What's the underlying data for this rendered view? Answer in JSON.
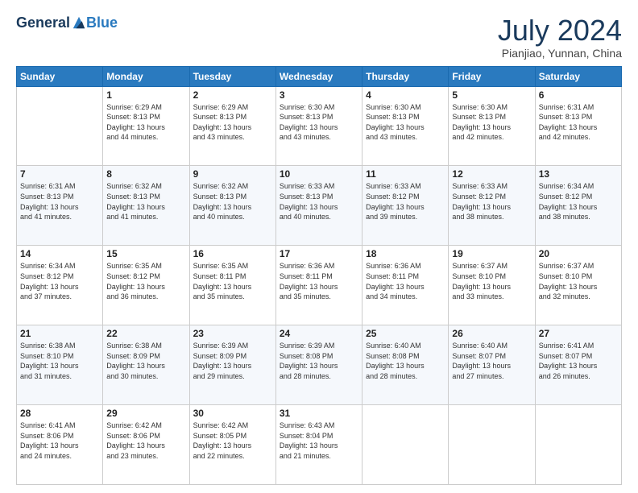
{
  "header": {
    "logo_general": "General",
    "logo_blue": "Blue",
    "main_title": "July 2024",
    "subtitle": "Pianjiao, Yunnan, China"
  },
  "calendar": {
    "days_of_week": [
      "Sunday",
      "Monday",
      "Tuesday",
      "Wednesday",
      "Thursday",
      "Friday",
      "Saturday"
    ],
    "weeks": [
      [
        {
          "day": "",
          "info": ""
        },
        {
          "day": "1",
          "info": "Sunrise: 6:29 AM\nSunset: 8:13 PM\nDaylight: 13 hours\nand 44 minutes."
        },
        {
          "day": "2",
          "info": "Sunrise: 6:29 AM\nSunset: 8:13 PM\nDaylight: 13 hours\nand 43 minutes."
        },
        {
          "day": "3",
          "info": "Sunrise: 6:30 AM\nSunset: 8:13 PM\nDaylight: 13 hours\nand 43 minutes."
        },
        {
          "day": "4",
          "info": "Sunrise: 6:30 AM\nSunset: 8:13 PM\nDaylight: 13 hours\nand 43 minutes."
        },
        {
          "day": "5",
          "info": "Sunrise: 6:30 AM\nSunset: 8:13 PM\nDaylight: 13 hours\nand 42 minutes."
        },
        {
          "day": "6",
          "info": "Sunrise: 6:31 AM\nSunset: 8:13 PM\nDaylight: 13 hours\nand 42 minutes."
        }
      ],
      [
        {
          "day": "7",
          "info": "Sunrise: 6:31 AM\nSunset: 8:13 PM\nDaylight: 13 hours\nand 41 minutes."
        },
        {
          "day": "8",
          "info": "Sunrise: 6:32 AM\nSunset: 8:13 PM\nDaylight: 13 hours\nand 41 minutes."
        },
        {
          "day": "9",
          "info": "Sunrise: 6:32 AM\nSunset: 8:13 PM\nDaylight: 13 hours\nand 40 minutes."
        },
        {
          "day": "10",
          "info": "Sunrise: 6:33 AM\nSunset: 8:13 PM\nDaylight: 13 hours\nand 40 minutes."
        },
        {
          "day": "11",
          "info": "Sunrise: 6:33 AM\nSunset: 8:12 PM\nDaylight: 13 hours\nand 39 minutes."
        },
        {
          "day": "12",
          "info": "Sunrise: 6:33 AM\nSunset: 8:12 PM\nDaylight: 13 hours\nand 38 minutes."
        },
        {
          "day": "13",
          "info": "Sunrise: 6:34 AM\nSunset: 8:12 PM\nDaylight: 13 hours\nand 38 minutes."
        }
      ],
      [
        {
          "day": "14",
          "info": "Sunrise: 6:34 AM\nSunset: 8:12 PM\nDaylight: 13 hours\nand 37 minutes."
        },
        {
          "day": "15",
          "info": "Sunrise: 6:35 AM\nSunset: 8:12 PM\nDaylight: 13 hours\nand 36 minutes."
        },
        {
          "day": "16",
          "info": "Sunrise: 6:35 AM\nSunset: 8:11 PM\nDaylight: 13 hours\nand 35 minutes."
        },
        {
          "day": "17",
          "info": "Sunrise: 6:36 AM\nSunset: 8:11 PM\nDaylight: 13 hours\nand 35 minutes."
        },
        {
          "day": "18",
          "info": "Sunrise: 6:36 AM\nSunset: 8:11 PM\nDaylight: 13 hours\nand 34 minutes."
        },
        {
          "day": "19",
          "info": "Sunrise: 6:37 AM\nSunset: 8:10 PM\nDaylight: 13 hours\nand 33 minutes."
        },
        {
          "day": "20",
          "info": "Sunrise: 6:37 AM\nSunset: 8:10 PM\nDaylight: 13 hours\nand 32 minutes."
        }
      ],
      [
        {
          "day": "21",
          "info": "Sunrise: 6:38 AM\nSunset: 8:10 PM\nDaylight: 13 hours\nand 31 minutes."
        },
        {
          "day": "22",
          "info": "Sunrise: 6:38 AM\nSunset: 8:09 PM\nDaylight: 13 hours\nand 30 minutes."
        },
        {
          "day": "23",
          "info": "Sunrise: 6:39 AM\nSunset: 8:09 PM\nDaylight: 13 hours\nand 29 minutes."
        },
        {
          "day": "24",
          "info": "Sunrise: 6:39 AM\nSunset: 8:08 PM\nDaylight: 13 hours\nand 28 minutes."
        },
        {
          "day": "25",
          "info": "Sunrise: 6:40 AM\nSunset: 8:08 PM\nDaylight: 13 hours\nand 28 minutes."
        },
        {
          "day": "26",
          "info": "Sunrise: 6:40 AM\nSunset: 8:07 PM\nDaylight: 13 hours\nand 27 minutes."
        },
        {
          "day": "27",
          "info": "Sunrise: 6:41 AM\nSunset: 8:07 PM\nDaylight: 13 hours\nand 26 minutes."
        }
      ],
      [
        {
          "day": "28",
          "info": "Sunrise: 6:41 AM\nSunset: 8:06 PM\nDaylight: 13 hours\nand 24 minutes."
        },
        {
          "day": "29",
          "info": "Sunrise: 6:42 AM\nSunset: 8:06 PM\nDaylight: 13 hours\nand 23 minutes."
        },
        {
          "day": "30",
          "info": "Sunrise: 6:42 AM\nSunset: 8:05 PM\nDaylight: 13 hours\nand 22 minutes."
        },
        {
          "day": "31",
          "info": "Sunrise: 6:43 AM\nSunset: 8:04 PM\nDaylight: 13 hours\nand 21 minutes."
        },
        {
          "day": "",
          "info": ""
        },
        {
          "day": "",
          "info": ""
        },
        {
          "day": "",
          "info": ""
        }
      ]
    ]
  }
}
